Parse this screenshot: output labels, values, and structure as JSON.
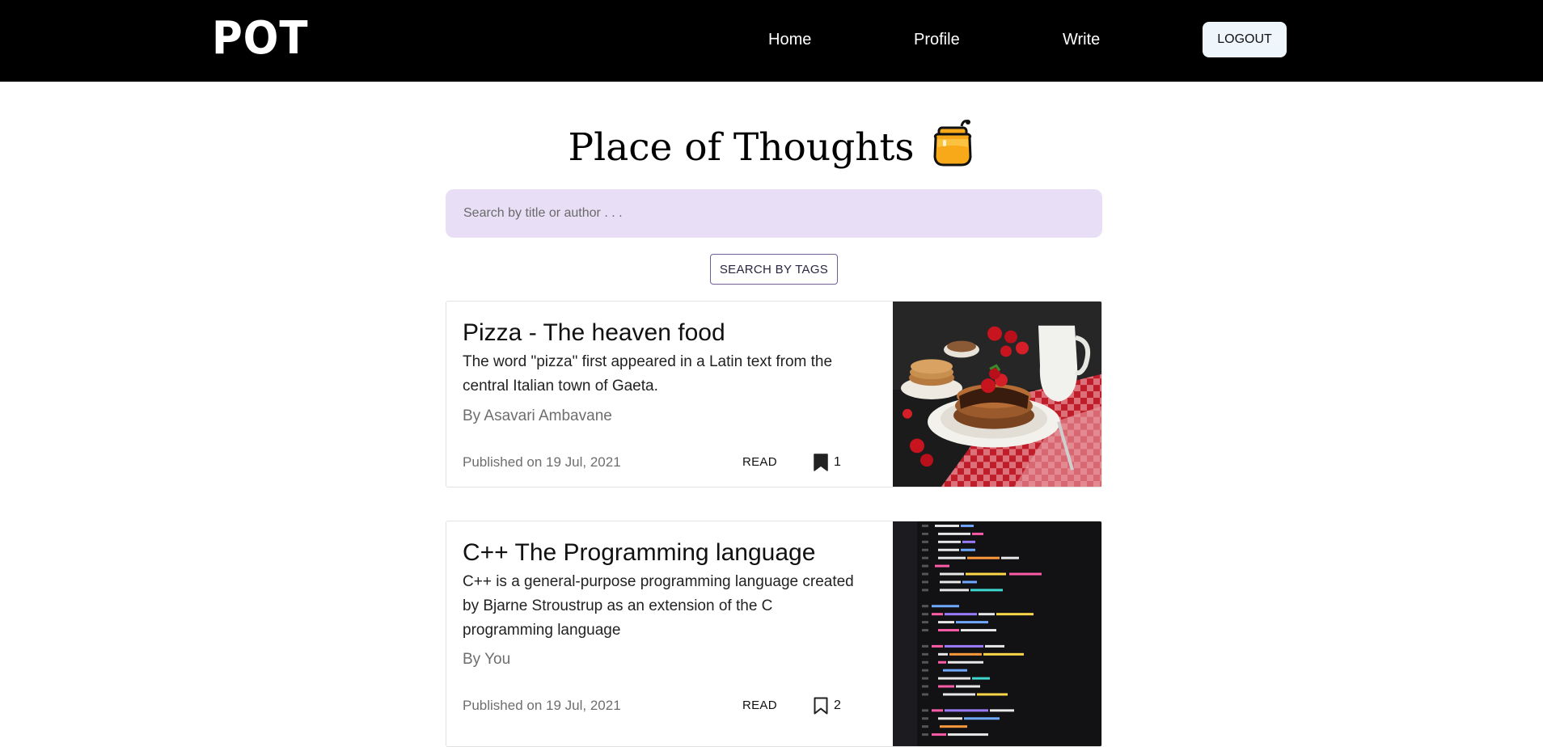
{
  "navbar": {
    "logo": "POT",
    "links": [
      {
        "label": "Home"
      },
      {
        "label": "Profile"
      },
      {
        "label": "Write"
      }
    ],
    "logout_label": "LOGOUT"
  },
  "main": {
    "title": "Place of Thoughts",
    "title_icon": "honey-pot-icon",
    "search": {
      "placeholder": "Search by title or author . . .",
      "value": ""
    },
    "tags_button": "SEARCH BY TAGS"
  },
  "posts": [
    {
      "title": "Pizza - The heaven food",
      "description": "The word \"pizza\" first appeared in a Latin text from the central Italian town of Gaeta.",
      "author": "By Asavari Ambavane",
      "published": "Published on 19 Jul, 2021",
      "read_label": "READ",
      "bookmark_count": "1",
      "bookmarked": true,
      "image": "pancakes-photo"
    },
    {
      "title": "C++ The Programming language",
      "description": "C++ is a general-purpose programming language created by Bjarne Stroustrup as an extension of the C programming language",
      "author": "By You",
      "published": "Published on 19 Jul, 2021",
      "read_label": "READ",
      "bookmark_count": "2",
      "bookmarked": false,
      "image": "code-screen-photo"
    }
  ],
  "colors": {
    "navbar_bg": "#000000",
    "search_bg": "#e8dff6",
    "logout_bg": "#eef6fc",
    "tags_border": "#6f5f93"
  }
}
